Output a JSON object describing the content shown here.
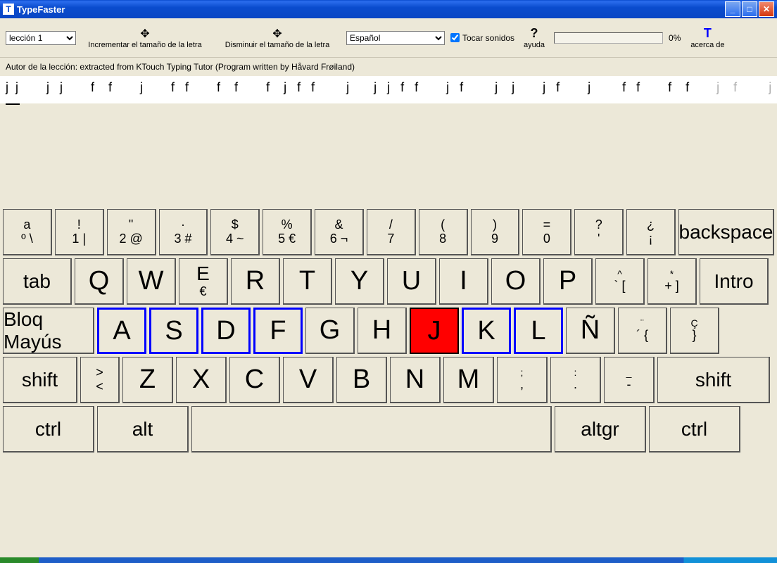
{
  "titlebar": {
    "title": "TypeFaster"
  },
  "toolbar": {
    "lesson": "lección 1",
    "increase_font": "Incrementar el tamaño de la letra",
    "decrease_font": "Disminuir el tamaño de la letra",
    "language": "Español",
    "play_sounds": "Tocar sonidos",
    "help": "ayuda",
    "percent": "0%",
    "about": "acerca de",
    "about_icon": "T",
    "help_icon": "?"
  },
  "author": "Autor de la lección: extracted from KTouch Typing Tutor (Program written by Håvard Frøiland)",
  "practice_text": "j  j        j   j        f    f        j        f   f        f    f        f    j   f   f         j       j   j   f   f        j   f         j    j        j   f        j         f   f        f    f",
  "practice_remaining": "       j    f         j    j",
  "keyboard": {
    "row1": [
      {
        "top": "a",
        "bot": "º  \\"
      },
      {
        "top": "!",
        "bot": "1 |"
      },
      {
        "top": "\"",
        "bot": "2 @"
      },
      {
        "top": "·",
        "bot": "3 #"
      },
      {
        "top": "$",
        "bot": "4 ~"
      },
      {
        "top": "%",
        "bot": "5 €"
      },
      {
        "top": "&",
        "bot": "6 ¬"
      },
      {
        "top": "/",
        "bot": "7"
      },
      {
        "top": "(",
        "bot": "8"
      },
      {
        "top": ")",
        "bot": "9"
      },
      {
        "top": "=",
        "bot": "0"
      },
      {
        "top": "?",
        "bot": "'"
      },
      {
        "top": "¿",
        "bot": "¡"
      }
    ],
    "backspace": "backspace",
    "tab": "tab",
    "row2": [
      "Q",
      "W"
    ],
    "row2_e": {
      "top": "E",
      "bot": "€"
    },
    "row2b": [
      "R",
      "T",
      "Y",
      "U",
      "I",
      "O",
      "P"
    ],
    "row2_end1": {
      "top": "^",
      "bot": "` ["
    },
    "row2_end2": {
      "top": "*",
      "bot": "+ ]"
    },
    "intro": "Intro",
    "capslock": "Bloq Mayús",
    "row3": [
      "A",
      "S",
      "D",
      "F",
      "G",
      "H",
      "J",
      "K",
      "L",
      "Ñ"
    ],
    "row3_end1": {
      "top": "¨",
      "bot": "´ {"
    },
    "row3_end2": {
      "top": "Ç",
      "bot": "}"
    },
    "shift_l": "shift",
    "row4_first": {
      "top": ">",
      "bot": "<"
    },
    "row4": [
      "Z",
      "X",
      "C",
      "V",
      "B",
      "N",
      "M"
    ],
    "row4_end1": {
      "top": ";",
      "bot": ","
    },
    "row4_end2": {
      "top": ":",
      "bot": "."
    },
    "row4_end3": {
      "top": "_",
      "bot": "-"
    },
    "shift_r": "shift",
    "ctrl_l": "ctrl",
    "alt": "alt",
    "altgr": "altgr",
    "ctrl_r": "ctrl"
  }
}
